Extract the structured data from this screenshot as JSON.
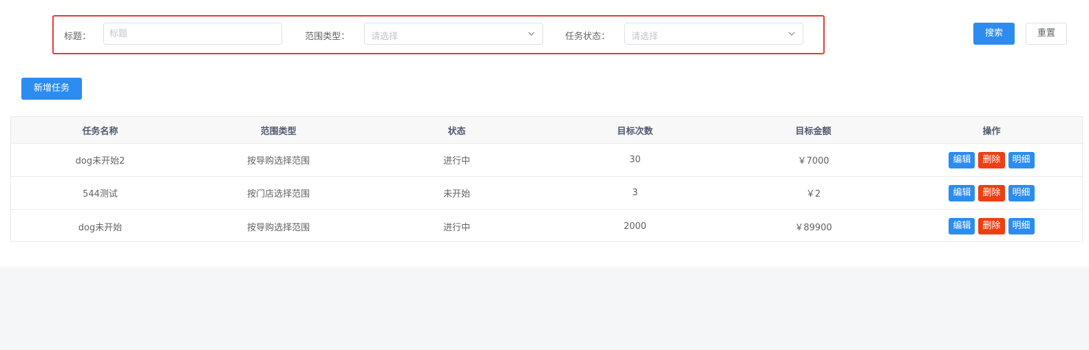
{
  "search": {
    "title_label": "标题：",
    "title_placeholder": "标题",
    "scope_label": "范围类型：",
    "scope_placeholder": "请选择",
    "status_label": "任务状态：",
    "status_placeholder": "请选择",
    "search_button": "搜索",
    "reset_button": "重置",
    "highlight_color": "#e53935"
  },
  "toolbar": {
    "add_button": "新增任务"
  },
  "table": {
    "headers": [
      "任务名称",
      "范围类型",
      "状态",
      "目标次数",
      "目标金额",
      "操作"
    ],
    "rows": [
      {
        "name": "dog未开始2",
        "scope": "按导购选择范围",
        "status": "进行中",
        "count": "30",
        "amount": "￥7000"
      },
      {
        "name": "544测试",
        "scope": "按门店选择范围",
        "status": "未开始",
        "count": "3",
        "amount": "￥2"
      },
      {
        "name": "dog未开始",
        "scope": "按导购选择范围",
        "status": "进行中",
        "count": "2000",
        "amount": "￥89900"
      }
    ],
    "actions": {
      "edit": "编辑",
      "delete": "删除",
      "detail": "明细"
    }
  },
  "colors": {
    "primary": "#2d8cf0",
    "danger": "#ed3f14"
  }
}
